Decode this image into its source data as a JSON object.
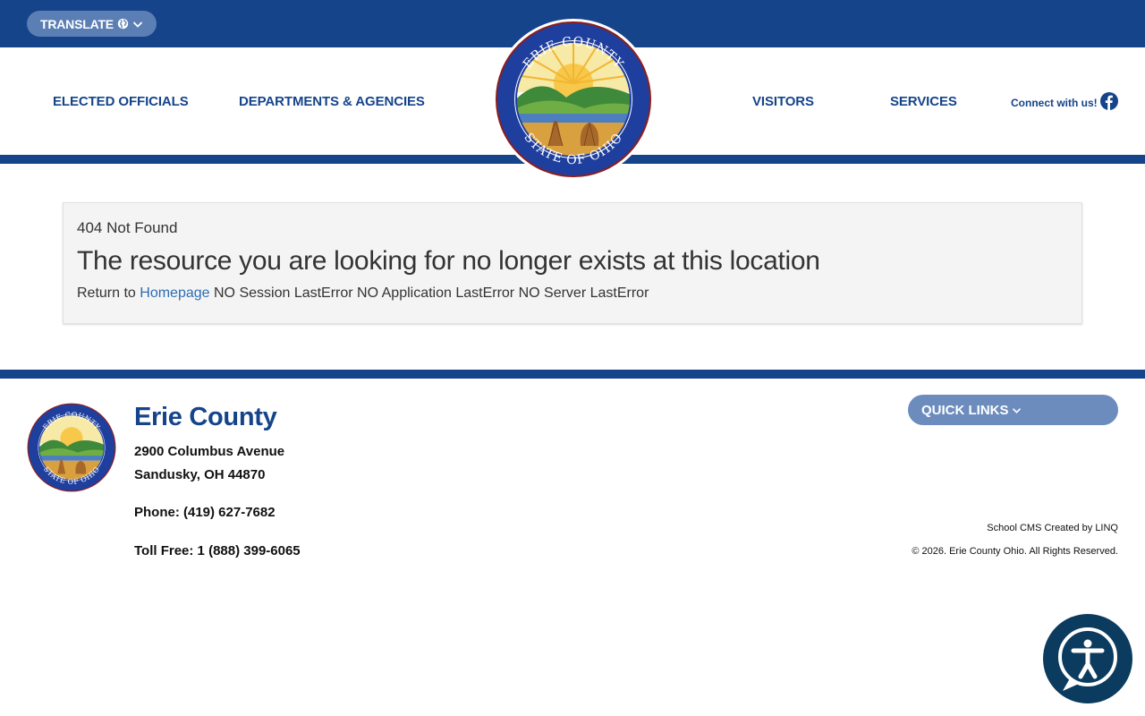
{
  "topbar": {
    "translate_label": "TRANSLATE",
    "globe_icon": "globe-icon",
    "chevron_icon": "chevron-down-icon"
  },
  "nav": {
    "elected_officials": "ELECTED OFFICIALS",
    "departments": "DEPARTMENTS & AGENCIES",
    "visitors": "VISITORS",
    "services": "SERVICES",
    "connect": "Connect with us!",
    "facebook_icon": "facebook-icon"
  },
  "seal": {
    "top_text": "ERIE COUNTY",
    "bottom_text": "STATE OF OHIO"
  },
  "error": {
    "code": "404 Not Found",
    "title": "The resource you are looking for no longer exists at this location",
    "return_prefix": "Return to",
    "homepage_link": "Homepage",
    "details": "NO Session LastError NO Application LastError NO Server LastError"
  },
  "footer": {
    "title": "Erie County",
    "address_line1": "2900 Columbus Avenue",
    "address_line2": "Sandusky, OH 44870",
    "phone": "Phone: (419) 627-7682",
    "toll_free": "Toll Free: 1 (888) 399-6065",
    "quick_links": "QUICK LINKS",
    "cms_credit": "School CMS Created by LINQ",
    "copyright": "© 2026. Erie County Ohio. All Rights Reserved."
  },
  "accessibility": {
    "icon": "accessibility-icon"
  },
  "colors": {
    "brand_blue": "#15448b",
    "link_blue": "#2d6db5",
    "pill_blue": "#6b8cbd",
    "a11y_navy": "#0b3b5e"
  }
}
